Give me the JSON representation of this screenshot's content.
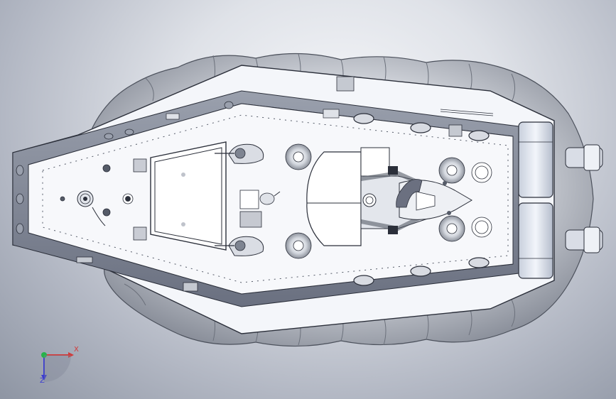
{
  "viewport": {
    "background": [
      "#f6f7fa",
      "#dfe2e8",
      "#b3b8c4",
      "#8e95a3"
    ]
  },
  "model": {
    "hull_color": "#f4f6fa",
    "skirt_color": "#d9dce2",
    "rail_color": "#7b8190",
    "edge_color": "#2b2f3a",
    "thruster_color": "#dfe4ee"
  },
  "triad": {
    "x_label": "X",
    "z_label": "Z",
    "x_color": "#d23a3a",
    "y_color": "#27b34a",
    "z_color": "#3a3ad2"
  }
}
